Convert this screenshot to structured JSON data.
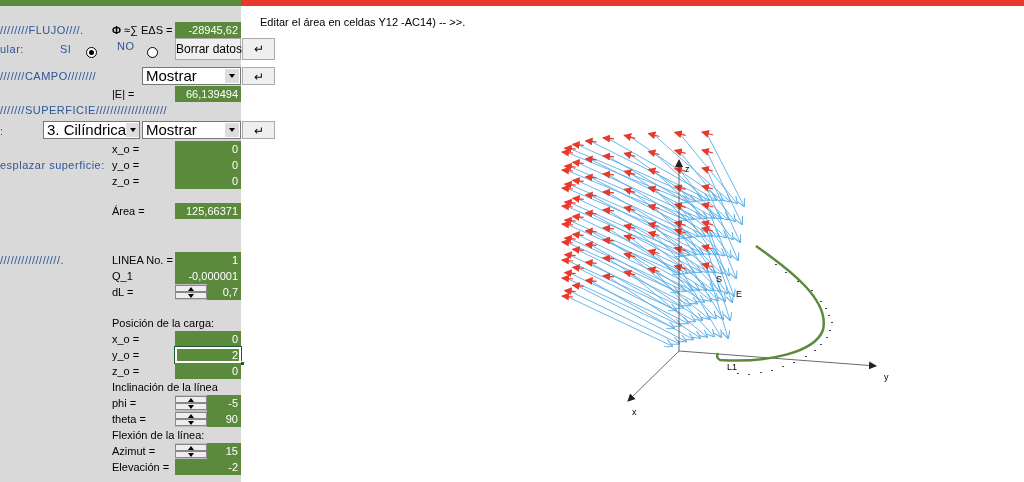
{
  "panel": {
    "sections": [
      {
        "rows": [
          {
            "kind": "cell",
            "left": "////////FLUJO////.",
            "label": "**Φ** ≈∑ EΔS =",
            "value": "-28945,62"
          },
          {
            "kind": "radio",
            "left": "ular:",
            "options": [
              {
                "label": "SI",
                "selected": true
              },
              {
                "label": "NO",
                "selected": false
              }
            ],
            "button": "Borrar datos",
            "enter": "↵"
          },
          {
            "kind": "select",
            "left": "///////CAMPO////////",
            "selects": [
              "Mostrar"
            ],
            "enter": "↵"
          },
          {
            "kind": "cell",
            "label": "|E| =",
            "value": "66,139494"
          },
          {
            "kind": "heading",
            "text": "///////SUPERFICIE////////////////////"
          },
          {
            "kind": "select",
            "left": ":",
            "selects": [
              "3. Cilíndrica",
              "Mostrar"
            ],
            "enter": "↵"
          },
          {
            "kind": "cell",
            "label": "x_o =",
            "value": "0"
          },
          {
            "kind": "cell",
            "left": "esplazar superficie:",
            "label": "y_o =",
            "value": "0"
          },
          {
            "kind": "cell",
            "label": "z_o =",
            "value": "0"
          }
        ]
      },
      {
        "rows": [
          {
            "kind": "cell",
            "label": "Área =",
            "value": "125,66371"
          }
        ]
      },
      {
        "rows": [
          {
            "kind": "cell",
            "left": "/////////////////.",
            "label": "LINEA No. =",
            "value": "1"
          },
          {
            "kind": "cell",
            "label": "Q_1",
            "value": "-0,000001"
          },
          {
            "kind": "cell",
            "label": "dL =",
            "value": "0,7",
            "spinner": true
          }
        ]
      },
      {
        "rows": [
          {
            "kind": "text",
            "label": "Posición de la carga:"
          },
          {
            "kind": "cell",
            "label": "x_o =",
            "value": "0"
          },
          {
            "kind": "cell",
            "label": "y_o =",
            "value": "2",
            "selected": true
          },
          {
            "kind": "cell",
            "label": "z_o =",
            "value": "0"
          },
          {
            "kind": "text",
            "label": "Inclinación de la línea"
          },
          {
            "kind": "cell",
            "label": "phi =",
            "value": "-5",
            "spinner": true
          },
          {
            "kind": "cell",
            "label": "theta =",
            "value": "90",
            "spinner": true
          },
          {
            "kind": "text",
            "label": "Flexión de la línea:"
          },
          {
            "kind": "cell",
            "label": "Azimut =",
            "value": "15",
            "spinner": true
          },
          {
            "kind": "cell",
            "label": "Elevación =",
            "value": "-2"
          }
        ]
      }
    ]
  },
  "note": "Editar el área en celdas  Y12 -AC14) -- >>.",
  "plot": {
    "labels": [
      {
        "kind": "z-axis",
        "text": "z"
      },
      {
        "kind": "y-axis",
        "text": "y"
      },
      {
        "kind": "x-axis",
        "text": "x"
      },
      {
        "kind": "surface",
        "text": "S"
      },
      {
        "kind": "field",
        "text": "E"
      },
      {
        "kind": "line",
        "text": "L1"
      }
    ]
  }
}
